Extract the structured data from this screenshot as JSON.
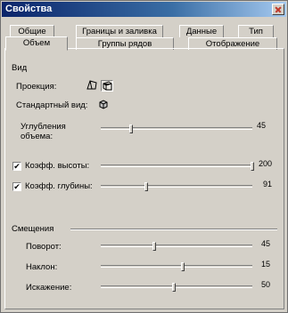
{
  "window": {
    "title": "Свойства"
  },
  "tabs": {
    "back_row": [
      {
        "label": "Общие"
      },
      {
        "label": "Границы и заливка"
      },
      {
        "label": "Данные"
      },
      {
        "label": "Тип"
      }
    ],
    "front_row": [
      {
        "label": "Объем",
        "active": true
      },
      {
        "label": "Группы рядов"
      },
      {
        "label": "Отображение"
      }
    ]
  },
  "view": {
    "section_label": "Вид",
    "projection_label": "Проекция:",
    "projection_icons": [
      "perspective-icon",
      "axonometric-icon"
    ],
    "standard_view_label": "Стандартный вид:",
    "standard_view_icon": "cube-view-icon",
    "depth_label_line1": "Углубления",
    "depth_label_line2": "объема:",
    "depth_value": "45",
    "depth_level": 0.2
  },
  "coeffs": {
    "height_label": "Коэфф. высоты:",
    "height_checked": true,
    "height_value": "200",
    "height_level": 1.0,
    "depth_label": "Коэфф. глубины:",
    "depth_checked": true,
    "depth_value": "91",
    "depth_level": 0.3
  },
  "rotation": {
    "section_label": "Смещения",
    "turn_label": "Поворот:",
    "turn_value": "45",
    "turn_level": 0.35,
    "tilt_label": "Наклон:",
    "tilt_value": "15",
    "tilt_level": 0.54,
    "distortion_label": "Искажение:",
    "distortion_value": "50",
    "distortion_level": 0.48
  }
}
